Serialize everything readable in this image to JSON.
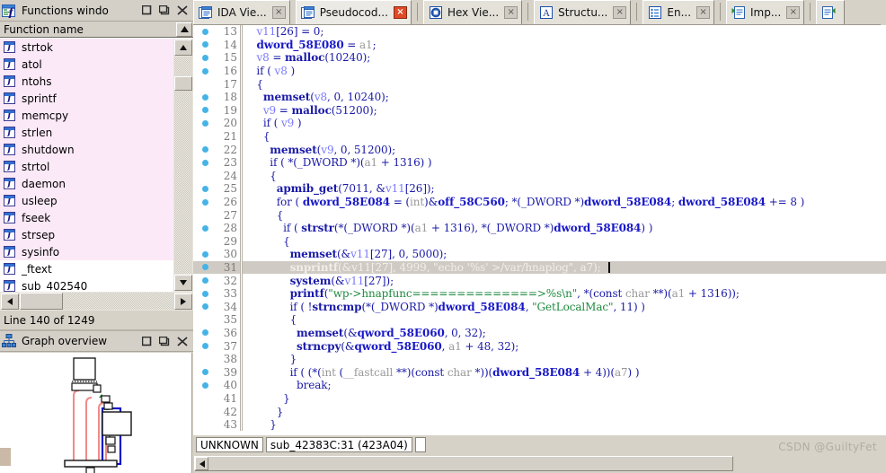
{
  "functions_window": {
    "title": "Functions windo",
    "icon": "functions-window-icon",
    "buttons": {
      "restore": "❑",
      "maximize": "❐",
      "close": "×"
    },
    "column_header": "Function name",
    "items": [
      {
        "label": "strtok",
        "icon": "function-icon",
        "selected": true
      },
      {
        "label": "atol",
        "icon": "function-icon",
        "selected": true
      },
      {
        "label": "ntohs",
        "icon": "function-icon",
        "selected": true
      },
      {
        "label": "sprintf",
        "icon": "function-icon",
        "selected": true
      },
      {
        "label": "memcpy",
        "icon": "function-icon",
        "selected": true
      },
      {
        "label": "strlen",
        "icon": "function-icon",
        "selected": true
      },
      {
        "label": "shutdown",
        "icon": "function-icon",
        "selected": true
      },
      {
        "label": "strtol",
        "icon": "function-icon",
        "selected": true
      },
      {
        "label": "daemon",
        "icon": "function-icon",
        "selected": true
      },
      {
        "label": "usleep",
        "icon": "function-icon",
        "selected": true
      },
      {
        "label": "fseek",
        "icon": "function-icon",
        "selected": true
      },
      {
        "label": "strsep",
        "icon": "function-icon",
        "selected": true
      },
      {
        "label": "sysinfo",
        "icon": "function-icon",
        "selected": true
      },
      {
        "label": "_ftext",
        "icon": "function-icon",
        "selected": false
      },
      {
        "label": "sub_402540",
        "icon": "function-icon",
        "selected": false
      }
    ],
    "status": "Line 140 of 1249"
  },
  "graph_overview": {
    "title": "Graph overview",
    "icon": "graph-overview-icon",
    "buttons": {
      "restore": "❑",
      "maximize": "❐",
      "close": "×"
    }
  },
  "tabs": [
    {
      "label": "IDA Vie...",
      "icon": "ida-view-icon",
      "close": "×",
      "close_style": "gray",
      "active": false
    },
    {
      "label": "Pseudocod...",
      "icon": "pseudocode-icon",
      "close": "×",
      "close_style": "red",
      "active": true
    },
    {
      "label": "Hex Vie...",
      "icon": "hex-view-icon",
      "close": "×",
      "close_style": "gray",
      "active": false
    },
    {
      "label": "Structu...",
      "icon": "structures-icon",
      "close": "×",
      "close_style": "gray",
      "active": false
    },
    {
      "label": "En...",
      "icon": "enums-icon",
      "close": "×",
      "close_style": "gray",
      "active": false
    },
    {
      "label": "Imp...",
      "icon": "imports-icon",
      "close": "×",
      "close_style": "gray",
      "active": false
    },
    {
      "label": "",
      "icon": "exports-icon",
      "close": "",
      "close_style": "none",
      "active": false
    }
  ],
  "code": {
    "lines": [
      {
        "n": "13",
        "dot": true,
        "highlight": false,
        "tokens": [
          {
            "t": "  ",
            "c": "k"
          },
          {
            "t": "v11",
            "c": "id"
          },
          {
            "t": "[26] = 0;",
            "c": "k"
          }
        ]
      },
      {
        "n": "14",
        "dot": true,
        "highlight": false,
        "tokens": [
          {
            "t": "  ",
            "c": "k"
          },
          {
            "t": "dword_58E080",
            "c": "gl"
          },
          {
            "t": " = ",
            "c": "k"
          },
          {
            "t": "a1",
            "c": "ty"
          },
          {
            "t": ";",
            "c": "k"
          }
        ]
      },
      {
        "n": "15",
        "dot": true,
        "highlight": false,
        "tokens": [
          {
            "t": "  ",
            "c": "k"
          },
          {
            "t": "v8",
            "c": "id"
          },
          {
            "t": " = ",
            "c": "k"
          },
          {
            "t": "malloc",
            "c": "fn"
          },
          {
            "t": "(10240);",
            "c": "k"
          }
        ]
      },
      {
        "n": "16",
        "dot": true,
        "highlight": false,
        "tokens": [
          {
            "t": "  if ( ",
            "c": "k"
          },
          {
            "t": "v8",
            "c": "id"
          },
          {
            "t": " )",
            "c": "k"
          }
        ]
      },
      {
        "n": "17",
        "dot": false,
        "highlight": false,
        "tokens": [
          {
            "t": "  {",
            "c": "k"
          }
        ]
      },
      {
        "n": "18",
        "dot": true,
        "highlight": false,
        "tokens": [
          {
            "t": "    ",
            "c": "k"
          },
          {
            "t": "memset",
            "c": "fn"
          },
          {
            "t": "(",
            "c": "k"
          },
          {
            "t": "v8",
            "c": "id"
          },
          {
            "t": ", 0, 10240);",
            "c": "k"
          }
        ]
      },
      {
        "n": "19",
        "dot": true,
        "highlight": false,
        "tokens": [
          {
            "t": "    ",
            "c": "k"
          },
          {
            "t": "v9",
            "c": "id"
          },
          {
            "t": " = ",
            "c": "k"
          },
          {
            "t": "malloc",
            "c": "fn"
          },
          {
            "t": "(51200);",
            "c": "k"
          }
        ]
      },
      {
        "n": "20",
        "dot": true,
        "highlight": false,
        "tokens": [
          {
            "t": "    if ( ",
            "c": "k"
          },
          {
            "t": "v9",
            "c": "id"
          },
          {
            "t": " )",
            "c": "k"
          }
        ]
      },
      {
        "n": "21",
        "dot": false,
        "highlight": false,
        "tokens": [
          {
            "t": "    {",
            "c": "k"
          }
        ]
      },
      {
        "n": "22",
        "dot": true,
        "highlight": false,
        "tokens": [
          {
            "t": "      ",
            "c": "k"
          },
          {
            "t": "memset",
            "c": "fn"
          },
          {
            "t": "(",
            "c": "k"
          },
          {
            "t": "v9",
            "c": "id"
          },
          {
            "t": ", 0, 51200);",
            "c": "k"
          }
        ]
      },
      {
        "n": "23",
        "dot": true,
        "highlight": false,
        "tokens": [
          {
            "t": "      if ( *(_DWORD *)(",
            "c": "k"
          },
          {
            "t": "a1",
            "c": "ty"
          },
          {
            "t": " + 1316) )",
            "c": "k"
          }
        ]
      },
      {
        "n": "24",
        "dot": false,
        "highlight": false,
        "tokens": [
          {
            "t": "      {",
            "c": "k"
          }
        ]
      },
      {
        "n": "25",
        "dot": true,
        "highlight": false,
        "tokens": [
          {
            "t": "        ",
            "c": "k"
          },
          {
            "t": "apmib_get",
            "c": "fn"
          },
          {
            "t": "(7011, &",
            "c": "k"
          },
          {
            "t": "v11",
            "c": "id"
          },
          {
            "t": "[26]);",
            "c": "k"
          }
        ]
      },
      {
        "n": "26",
        "dot": true,
        "highlight": false,
        "tokens": [
          {
            "t": "        for ( ",
            "c": "k"
          },
          {
            "t": "dword_58E084",
            "c": "gl"
          },
          {
            "t": " = (",
            "c": "k"
          },
          {
            "t": "int",
            "c": "ty"
          },
          {
            "t": ")&",
            "c": "k"
          },
          {
            "t": "off_58C560",
            "c": "gl"
          },
          {
            "t": "; *(_DWORD *)",
            "c": "k"
          },
          {
            "t": "dword_58E084",
            "c": "gl"
          },
          {
            "t": "; ",
            "c": "k"
          },
          {
            "t": "dword_58E084",
            "c": "gl"
          },
          {
            "t": " += 8 )",
            "c": "k"
          }
        ]
      },
      {
        "n": "27",
        "dot": false,
        "highlight": false,
        "tokens": [
          {
            "t": "        {",
            "c": "k"
          }
        ]
      },
      {
        "n": "28",
        "dot": true,
        "highlight": false,
        "tokens": [
          {
            "t": "          if ( ",
            "c": "k"
          },
          {
            "t": "strstr",
            "c": "fn"
          },
          {
            "t": "(*(_DWORD *)(",
            "c": "k"
          },
          {
            "t": "a1",
            "c": "ty"
          },
          {
            "t": " + 1316), *(_DWORD *)",
            "c": "k"
          },
          {
            "t": "dword_58E084",
            "c": "gl"
          },
          {
            "t": ") )",
            "c": "k"
          }
        ]
      },
      {
        "n": "29",
        "dot": false,
        "highlight": false,
        "tokens": [
          {
            "t": "          {",
            "c": "k"
          }
        ]
      },
      {
        "n": "30",
        "dot": true,
        "highlight": false,
        "tokens": [
          {
            "t": "            ",
            "c": "k"
          },
          {
            "t": "memset",
            "c": "fn"
          },
          {
            "t": "(&",
            "c": "k"
          },
          {
            "t": "v11",
            "c": "id"
          },
          {
            "t": "[27], 0, 5000);",
            "c": "k"
          }
        ]
      },
      {
        "n": "31",
        "dot": true,
        "highlight": true,
        "tokens": [
          {
            "t": "            ",
            "c": "k"
          },
          {
            "t": "snprintf",
            "c": "fn"
          },
          {
            "t": "(&",
            "c": "k"
          },
          {
            "t": "v11",
            "c": "id"
          },
          {
            "t": "[27], 4999, ",
            "c": "k"
          },
          {
            "t": "\"echo '%s' >/var/hnaplog\"",
            "c": "st"
          },
          {
            "t": ", ",
            "c": "k"
          },
          {
            "t": "a7",
            "c": "ty"
          },
          {
            "t": ");",
            "c": "k"
          }
        ]
      },
      {
        "n": "32",
        "dot": true,
        "highlight": false,
        "tokens": [
          {
            "t": "            ",
            "c": "k"
          },
          {
            "t": "system",
            "c": "fn"
          },
          {
            "t": "(&",
            "c": "k"
          },
          {
            "t": "v11",
            "c": "id"
          },
          {
            "t": "[27]);",
            "c": "k"
          }
        ]
      },
      {
        "n": "33",
        "dot": true,
        "highlight": false,
        "tokens": [
          {
            "t": "            ",
            "c": "k"
          },
          {
            "t": "printf",
            "c": "fn"
          },
          {
            "t": "(",
            "c": "k"
          },
          {
            "t": "\"wp->hnapfunc==============>%s\\n\"",
            "c": "st"
          },
          {
            "t": ", *(const ",
            "c": "k"
          },
          {
            "t": "char",
            "c": "ty"
          },
          {
            "t": " **)(",
            "c": "k"
          },
          {
            "t": "a1",
            "c": "ty"
          },
          {
            "t": " + 1316));",
            "c": "k"
          }
        ]
      },
      {
        "n": "34",
        "dot": true,
        "highlight": false,
        "tokens": [
          {
            "t": "            if ( !",
            "c": "k"
          },
          {
            "t": "strncmp",
            "c": "fn"
          },
          {
            "t": "(*(_DWORD *)",
            "c": "k"
          },
          {
            "t": "dword_58E084",
            "c": "gl"
          },
          {
            "t": ", ",
            "c": "k"
          },
          {
            "t": "\"GetLocalMac\"",
            "c": "st"
          },
          {
            "t": ", 11) )",
            "c": "k"
          }
        ]
      },
      {
        "n": "35",
        "dot": false,
        "highlight": false,
        "tokens": [
          {
            "t": "            {",
            "c": "k"
          }
        ]
      },
      {
        "n": "36",
        "dot": true,
        "highlight": false,
        "tokens": [
          {
            "t": "              ",
            "c": "k"
          },
          {
            "t": "memset",
            "c": "fn"
          },
          {
            "t": "(&",
            "c": "k"
          },
          {
            "t": "qword_58E060",
            "c": "gl"
          },
          {
            "t": ", 0, 32);",
            "c": "k"
          }
        ]
      },
      {
        "n": "37",
        "dot": true,
        "highlight": false,
        "tokens": [
          {
            "t": "              ",
            "c": "k"
          },
          {
            "t": "strncpy",
            "c": "fn"
          },
          {
            "t": "(&",
            "c": "k"
          },
          {
            "t": "qword_58E060",
            "c": "gl"
          },
          {
            "t": ", ",
            "c": "k"
          },
          {
            "t": "a1",
            "c": "ty"
          },
          {
            "t": " + 48, 32);",
            "c": "k"
          }
        ]
      },
      {
        "n": "38",
        "dot": false,
        "highlight": false,
        "tokens": [
          {
            "t": "            }",
            "c": "k"
          }
        ]
      },
      {
        "n": "39",
        "dot": true,
        "highlight": false,
        "tokens": [
          {
            "t": "            if ( (*(",
            "c": "k"
          },
          {
            "t": "int",
            "c": "ty"
          },
          {
            "t": " (",
            "c": "k"
          },
          {
            "t": "__fastcall",
            "c": "ty"
          },
          {
            "t": " **)(const ",
            "c": "k"
          },
          {
            "t": "char",
            "c": "ty"
          },
          {
            "t": " *))(",
            "c": "k"
          },
          {
            "t": "dword_58E084",
            "c": "gl"
          },
          {
            "t": " + 4))(",
            "c": "k"
          },
          {
            "t": "a7",
            "c": "ty"
          },
          {
            "t": ") )",
            "c": "k"
          }
        ]
      },
      {
        "n": "40",
        "dot": true,
        "highlight": false,
        "tokens": [
          {
            "t": "              break;",
            "c": "k"
          }
        ]
      },
      {
        "n": "41",
        "dot": false,
        "highlight": false,
        "tokens": [
          {
            "t": "          }",
            "c": "k"
          }
        ]
      },
      {
        "n": "42",
        "dot": false,
        "highlight": false,
        "tokens": [
          {
            "t": "        }",
            "c": "k"
          }
        ]
      },
      {
        "n": "43",
        "dot": false,
        "highlight": false,
        "tokens": [
          {
            "t": "      }",
            "c": "k"
          }
        ]
      }
    ]
  },
  "status_bar": {
    "segment": "UNKNOWN",
    "address": "sub_42383C:31 (423A04)"
  },
  "watermark": "CSDN @GuiltyFet",
  "colors": {
    "chrome": "#d6d2c8",
    "code_bg": "#ffffff",
    "code_navy": "#1a1aa8",
    "local_var": "#7a7aff",
    "global": "#1818c8",
    "string_green": "#1f8a40",
    "type_gray": "#999999",
    "breakpoint_dot": "#46b3e6",
    "selection_row": "#cfcbc4",
    "list_selected": "#fbe9f7",
    "tab_close_red": "#e04a27"
  }
}
